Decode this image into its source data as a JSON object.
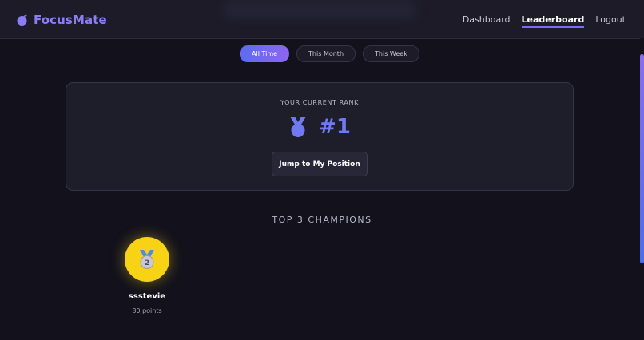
{
  "brand": {
    "name": "FocusMate",
    "logo_icon": "fruit-icon",
    "accent": "#8b7df5"
  },
  "nav": {
    "items": [
      {
        "label": "Dashboard",
        "active": false
      },
      {
        "label": "Leaderboard",
        "active": true
      },
      {
        "label": "Logout",
        "active": false
      }
    ]
  },
  "filters": {
    "options": [
      {
        "label": "All Time",
        "active": true
      },
      {
        "label": "This Month",
        "active": false
      },
      {
        "label": "This Week",
        "active": false
      }
    ]
  },
  "rank": {
    "label": "YOUR CURRENT RANK",
    "value": "#1",
    "icon": "medal-icon",
    "button_label": "Jump to My Position"
  },
  "champions": {
    "title": "TOP 3 CHAMPIONS",
    "list": [
      {
        "name": "ssstevie",
        "points": "80 points",
        "medal_number": "2",
        "circle_color": "#f7d215"
      }
    ]
  }
}
